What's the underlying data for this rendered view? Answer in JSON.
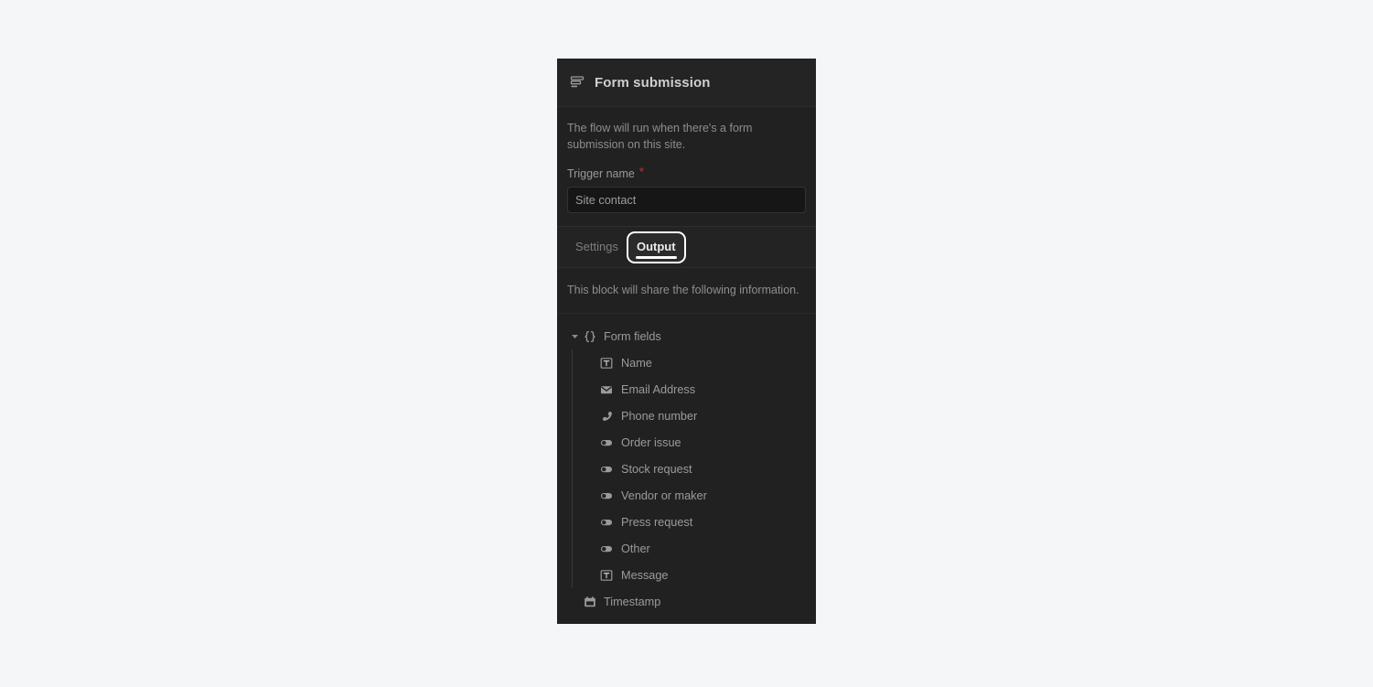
{
  "panel": {
    "header": {
      "icon": "form-icon",
      "title": "Form submission"
    },
    "description": "The flow will run when there's a form submission on this site.",
    "trigger_field": {
      "label": "Trigger name",
      "required_marker": "*",
      "value": "Site contact",
      "placeholder": "Site contact"
    },
    "tabs": [
      {
        "label": "Settings",
        "active": false
      },
      {
        "label": "Output",
        "active": true
      }
    ],
    "output_description": "This block will share the following information.",
    "tree": {
      "root": {
        "label": "Form fields",
        "icon": "braces-icon",
        "expanded": true,
        "caret": "chevron-down-icon"
      },
      "children": [
        {
          "label": "Name",
          "icon": "text-field-icon"
        },
        {
          "label": "Email Address",
          "icon": "envelope-icon"
        },
        {
          "label": "Phone number",
          "icon": "phone-icon"
        },
        {
          "label": "Order issue",
          "icon": "toggle-icon"
        },
        {
          "label": "Stock request",
          "icon": "toggle-icon"
        },
        {
          "label": "Vendor or maker",
          "icon": "toggle-icon"
        },
        {
          "label": "Press request",
          "icon": "toggle-icon"
        },
        {
          "label": "Other",
          "icon": "toggle-icon"
        },
        {
          "label": "Message",
          "icon": "text-field-icon"
        }
      ],
      "siblings": [
        {
          "label": "Timestamp",
          "icon": "calendar-icon"
        }
      ]
    }
  },
  "colors": {
    "page_background": "#f5f6f8",
    "panel_background": "#212121",
    "header_background": "#242424",
    "input_background": "#161616",
    "required_marker": "#cf3232",
    "focus_ring": "#ffffff",
    "text_primary": "#cfcfcf",
    "text_muted": "#8e8e8e"
  }
}
